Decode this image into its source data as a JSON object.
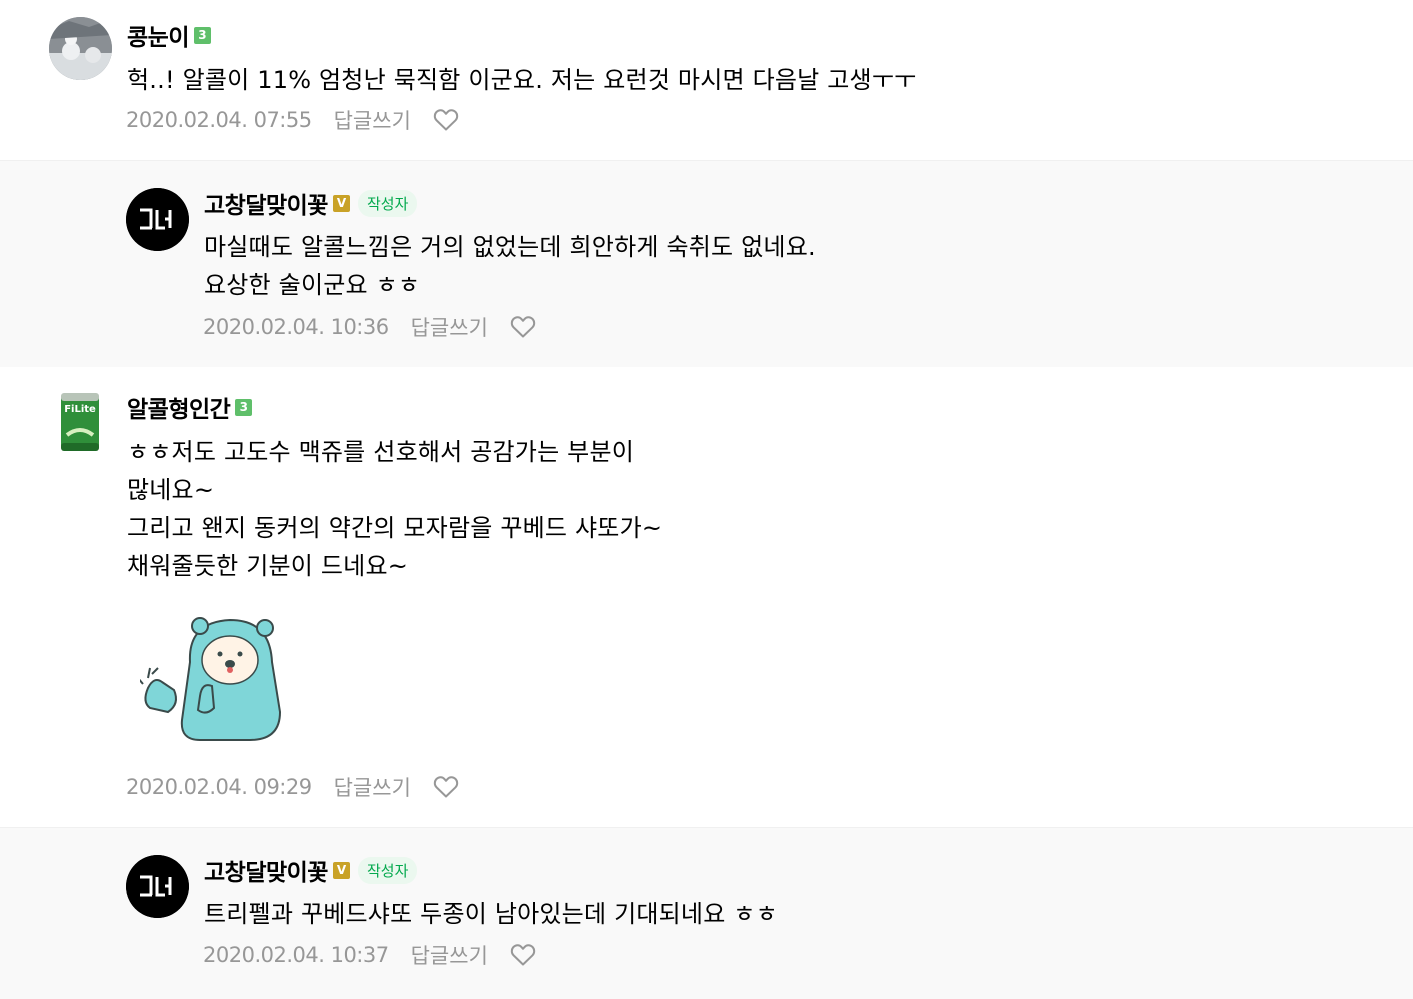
{
  "comments": [
    {
      "nickname": "콩눈이",
      "level": "3",
      "text": "헉..! 알콜이 11% 엄청난 묵직함 이군요. 저는 요런것 마시면 다음날 고생ㅜㅜ",
      "date": "2020.02.04. 07:55",
      "reply_label": "답글쓰기"
    },
    {
      "nickname": "고창달맞이꽃",
      "level": "V",
      "author_badge": "작성자",
      "avatar_text": "고달",
      "lines": [
        "마실때도 알콜느낌은 거의 없었는데 희안하게 숙취도 없네요.",
        "요상한 술이군요 ㅎㅎ"
      ],
      "date": "2020.02.04. 10:36",
      "reply_label": "답글쓰기"
    },
    {
      "nickname": "알콜형인간",
      "level": "3",
      "avatar_text": "FiLite",
      "lines": [
        "ㅎㅎ저도 고도수 맥쥬를 선호해서 공감가는 부분이",
        "많네요~",
        "그리고 왠지 동커의 약간의 모자람을 꾸베드 샤또가~",
        "채워줄듯한 기분이 드네요~"
      ],
      "date": "2020.02.04. 09:29",
      "reply_label": "답글쓰기"
    },
    {
      "nickname": "고창달맞이꽃",
      "level": "V",
      "author_badge": "작성자",
      "avatar_text": "고달",
      "text": "트리펠과 꾸베드샤또 두종이 남아있는데 기대되네요 ㅎㅎ",
      "date": "2020.02.04. 10:37",
      "reply_label": "답글쓰기"
    }
  ],
  "colors": {
    "level_green": "#5fbf6a",
    "level_gold": "#c9a227",
    "author_badge_text": "#03a94d",
    "meta_gray": "#979797",
    "reply_bg": "#f9f9f9",
    "sticker_bear": "#7fd6d8"
  },
  "icons": {
    "heart": "heart-outline-icon"
  }
}
